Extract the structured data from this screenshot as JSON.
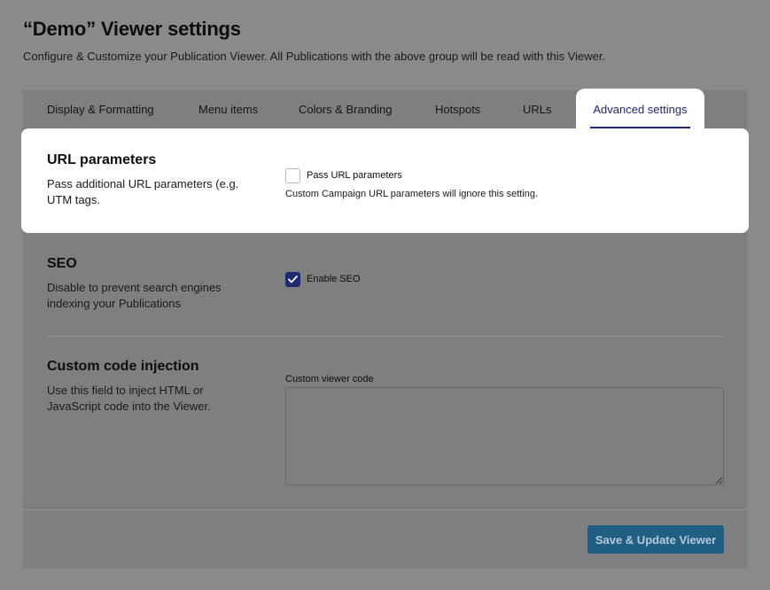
{
  "header": {
    "title": "“Demo” Viewer settings",
    "subtitle": "Configure & Customize your Publication Viewer. All Publications with the above group will be read with this Viewer."
  },
  "tabs": [
    {
      "label": "Display & Formatting"
    },
    {
      "label": "Menu items"
    },
    {
      "label": "Colors & Branding"
    },
    {
      "label": "Hotspots"
    },
    {
      "label": "URLs"
    },
    {
      "label": "Advanced settings",
      "active": true
    }
  ],
  "sections": {
    "url_params": {
      "title": "URL parameters",
      "description": "Pass additional URL parameters (e.g. UTM tags.",
      "checkbox_label": "Pass URL parameters",
      "checked": false,
      "hint": "Custom Campaign URL parameters will ignore this setting."
    },
    "seo": {
      "title": "SEO",
      "description": "Disable to prevent search engines indexing your Publications",
      "checkbox_label": "Enable SEO",
      "checked": true
    },
    "custom_code": {
      "title": "Custom code injection",
      "description": "Use this field to inject HTML or JavaScript code into the Viewer.",
      "field_label": "Custom viewer code",
      "value": ""
    }
  },
  "footer": {
    "save_label": "Save & Update Viewer"
  },
  "colors": {
    "accent": "#1e2a70",
    "button": "#1f5f83"
  }
}
